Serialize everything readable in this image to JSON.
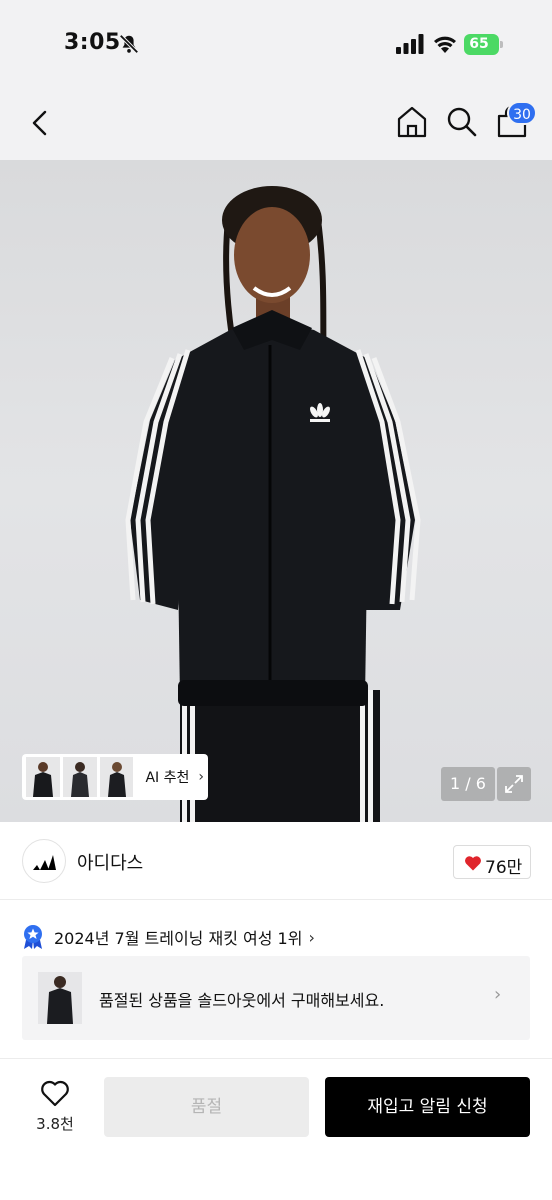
{
  "status_bar": {
    "time": "3:05",
    "battery": "65"
  },
  "nav": {
    "cart_badge": "30"
  },
  "gallery": {
    "ai_label": "AI 추천",
    "counter": "1 / 6"
  },
  "brand": {
    "name": "아디다스",
    "like_count": "76만"
  },
  "ranking": {
    "text": "2024년 7월 트레이닝 재킷 여성 1위"
  },
  "banner": {
    "text": "품절된 상품을 솔드아웃에서 구매해보세요."
  },
  "bottom": {
    "wish_count": "3.8천",
    "sold_out_label": "품절",
    "notify_label": "재입고 알림 신청"
  },
  "colors": {
    "accent_blue": "#2f6ff0",
    "heart_red": "#e0252c",
    "battery_green": "#4cd964"
  }
}
